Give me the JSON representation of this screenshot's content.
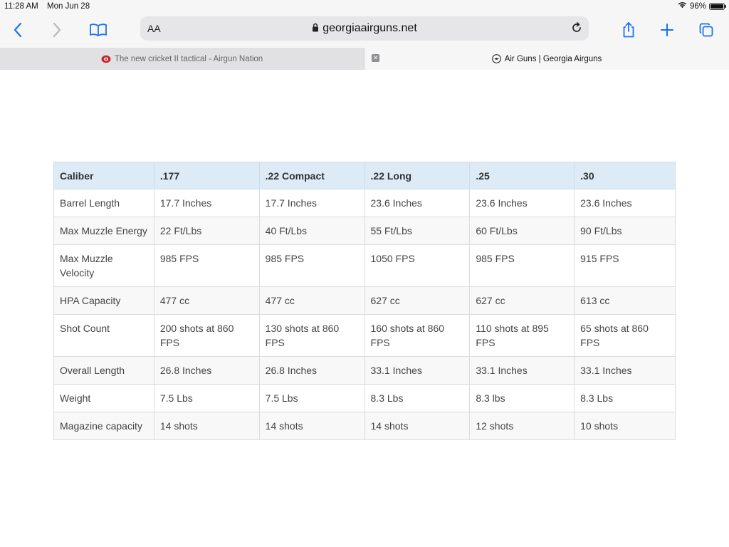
{
  "status": {
    "time": "11:28 AM",
    "date": "Mon Jun 28",
    "battery": "96%"
  },
  "toolbar": {
    "text_size_label": "AA",
    "url_host": "georgiaairguns.net"
  },
  "tabs": [
    {
      "title": "The new cricket II tactical - Airgun Nation",
      "active": false
    },
    {
      "title": "Air Guns | Georgia Airguns",
      "active": true
    }
  ],
  "table": {
    "headers": [
      "Caliber",
      ".177",
      ".22 Compact",
      ".22 Long",
      ".25",
      ".30"
    ],
    "rows": [
      [
        "Barrel Length",
        "17.7 Inches",
        "17.7 Inches",
        "23.6 Inches",
        "23.6 Inches",
        "23.6 Inches"
      ],
      [
        "Max Muzzle Energy",
        "22 Ft/Lbs",
        "40 Ft/Lbs",
        "55 Ft/Lbs",
        "60 Ft/Lbs",
        "90 Ft/Lbs"
      ],
      [
        "Max Muzzle Velocity",
        "985 FPS",
        "985 FPS",
        "1050 FPS",
        "985 FPS",
        "915 FPS"
      ],
      [
        "HPA Capacity",
        "477 cc",
        "477 cc",
        "627 cc",
        "627 cc",
        "613 cc"
      ],
      [
        "Shot Count",
        "200 shots at 860 FPS",
        "130 shots at 860 FPS",
        "160 shots at 860 FPS",
        "110 shots at 895 FPS",
        "65 shots at 860 FPS"
      ],
      [
        "Overall Length",
        "26.8 Inches",
        "26.8 Inches",
        "33.1 Inches",
        "33.1 Inches",
        "33.1 Inches"
      ],
      [
        "Weight",
        "7.5 Lbs",
        "7.5 Lbs",
        "8.3 Lbs",
        "8.3 lbs",
        "8.3 Lbs"
      ],
      [
        "Magazine capacity",
        "14 shots",
        "14 shots",
        "14 shots",
        "12 shots",
        "10 shots"
      ]
    ]
  },
  "colors": {
    "accent": "#1a73e8",
    "table_header_bg": "#dcebf6"
  },
  "icons": [
    "back-icon",
    "forward-icon",
    "bookmarks-icon",
    "lock-icon",
    "reload-icon",
    "share-icon",
    "new-tab-icon",
    "tabs-icon",
    "wifi-icon",
    "battery-icon",
    "tab-close-icon"
  ]
}
